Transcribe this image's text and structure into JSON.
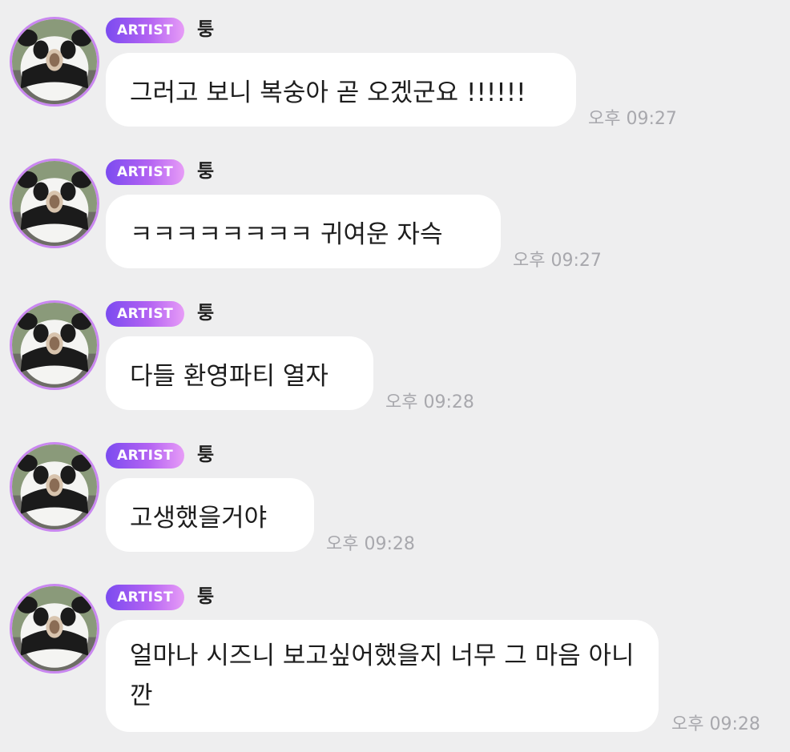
{
  "messages": [
    {
      "badge": "ARTIST",
      "name": "퉁",
      "text": "그러고 보니 복숭아 곧 오겠군요 !!!!!!",
      "time": "오후 09:27"
    },
    {
      "badge": "ARTIST",
      "name": "퉁",
      "text": "ㅋㅋㅋㅋㅋㅋㅋㅋ 귀여운 자슥",
      "time": "오후 09:27"
    },
    {
      "badge": "ARTIST",
      "name": "퉁",
      "text": "다들 환영파티 열자",
      "time": "오후 09:28"
    },
    {
      "badge": "ARTIST",
      "name": "퉁",
      "text": "고생했을거야",
      "time": "오후 09:28"
    },
    {
      "badge": "ARTIST",
      "name": "퉁",
      "text": "얼마나 시즈니 보고싶어했을지 너무 그 마음 아니깐",
      "time": "오후 09:28"
    }
  ],
  "colors": {
    "background": "#eeeeef",
    "bubble": "#ffffff",
    "badge_start": "#7b4bf0",
    "badge_end": "#e79cf7",
    "avatar_ring": "#c987f0",
    "time_text": "#a8a8ad"
  },
  "icons": {
    "avatar": "panda-avatar-icon"
  }
}
